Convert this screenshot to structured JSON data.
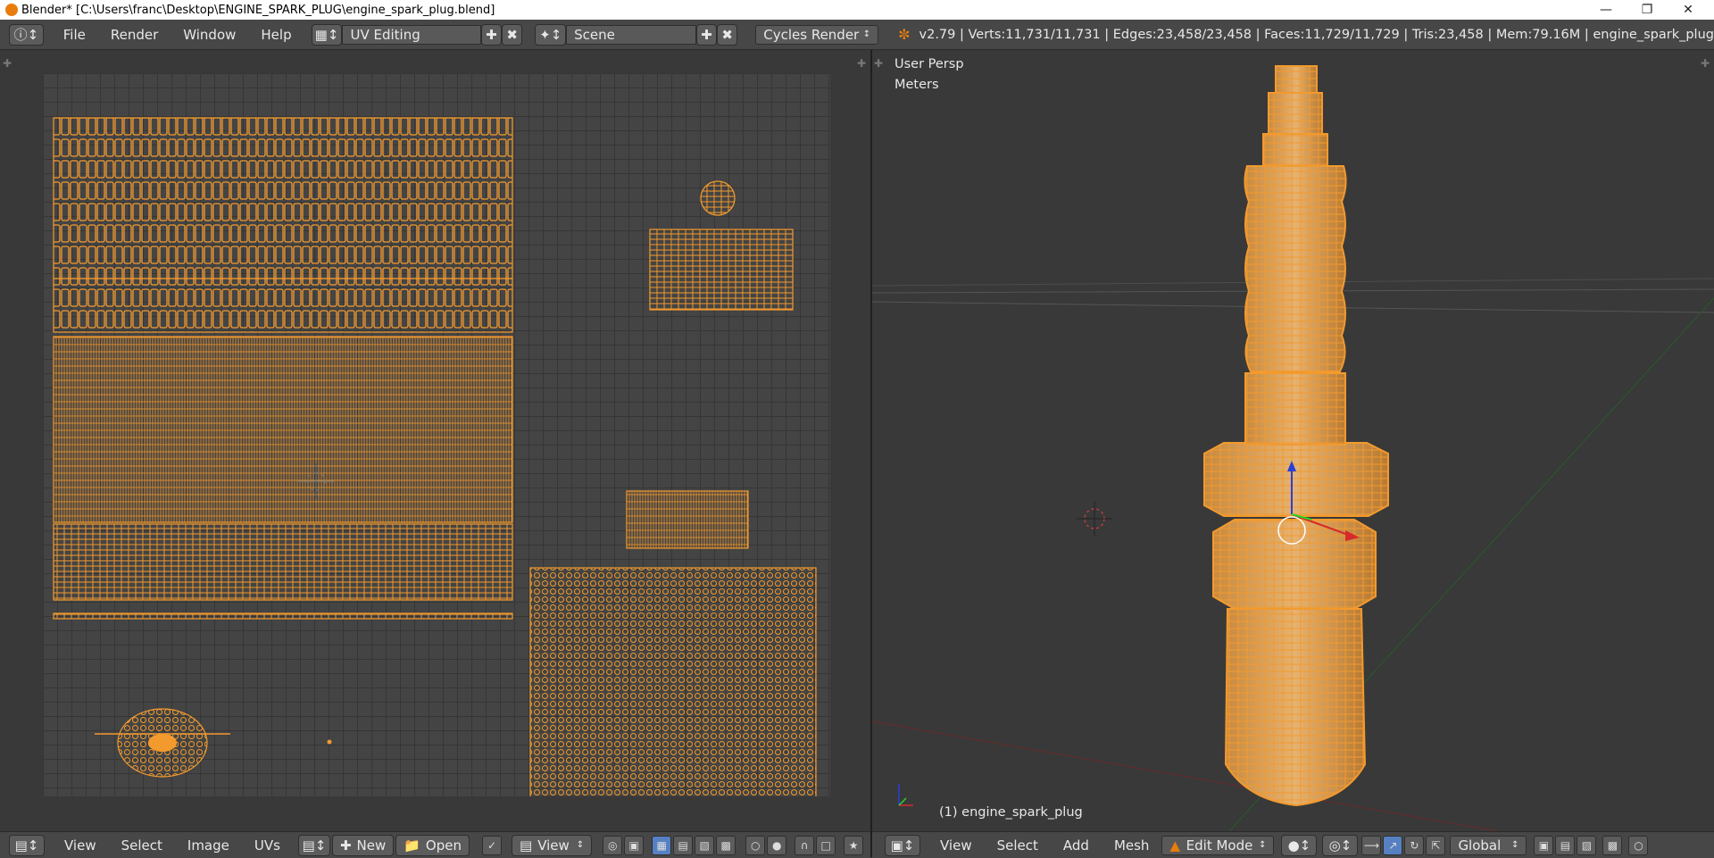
{
  "window": {
    "title": "Blender* [C:\\Users\\franc\\Desktop\\ENGINE_SPARK_PLUG\\engine_spark_plug.blend]",
    "minimize_icon": "minimize-icon",
    "maximize_icon": "restore-icon",
    "close_icon": "close-icon"
  },
  "topbar": {
    "menus": [
      "File",
      "Render",
      "Window",
      "Help"
    ],
    "screen_layout": "UV Editing",
    "scene": "Scene",
    "render_engine": "Cycles Render",
    "stats": "v2.79 | Verts:11,731/11,731 | Edges:23,458/23,458 | Faces:11,729/11,729 | Tris:23,458 | Mem:79.16M | engine_spark_plug"
  },
  "uv_editor": {
    "menus": [
      "View",
      "Select",
      "Image",
      "UVs"
    ],
    "new_label": "New",
    "open_label": "Open",
    "view_label": "View"
  },
  "viewport": {
    "view_name": "User Persp",
    "units": "Meters",
    "object_label": "(1) engine_spark_plug",
    "menus": [
      "View",
      "Select",
      "Add",
      "Mesh"
    ],
    "mode": "Edit Mode",
    "orientation": "Global"
  },
  "colors": {
    "accent": "#e8881a",
    "wire": "#f7a23a",
    "background": "#393939"
  }
}
